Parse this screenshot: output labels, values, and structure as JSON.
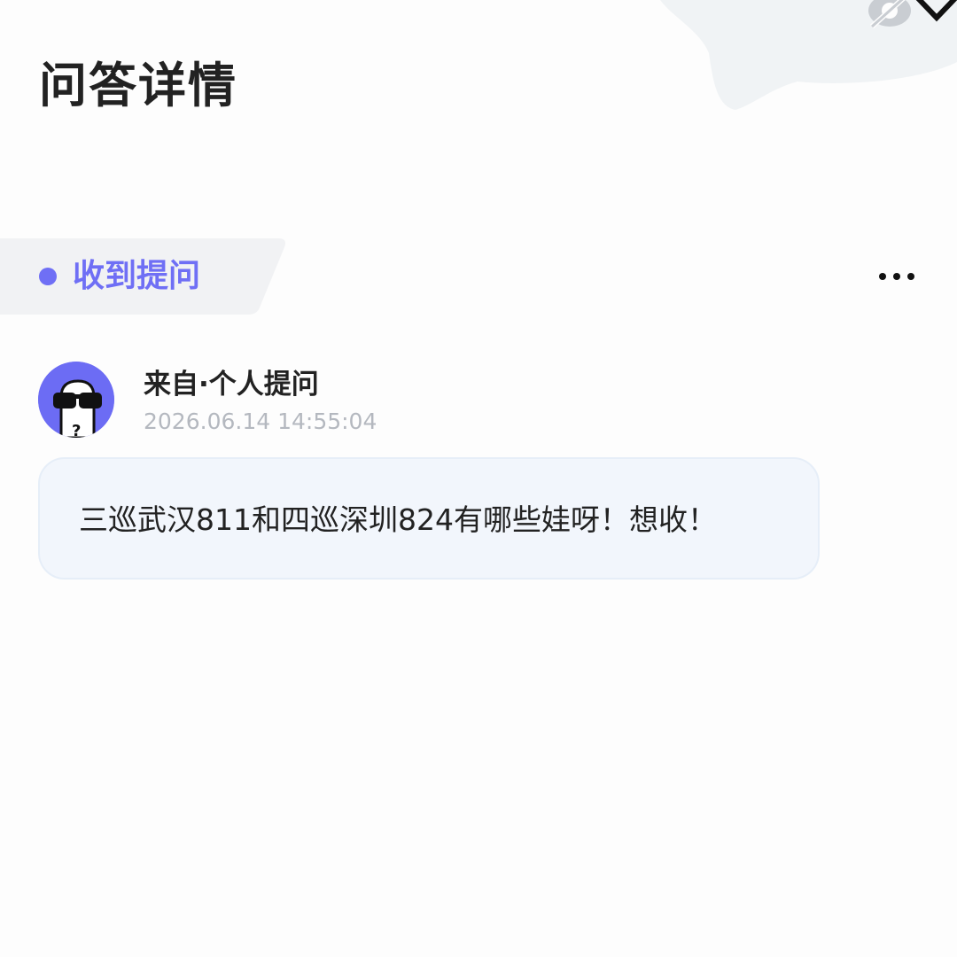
{
  "header": {
    "title": "问答详情",
    "icons": [
      "visibility-off-icon",
      "shield-icon"
    ]
  },
  "section": {
    "label": "收到提问",
    "more_icon": "more-icon"
  },
  "question": {
    "source": "来自·个人提问",
    "timestamp": "2026.06.14 14:55:04",
    "avatar_icon": "avatar-sunglasses-icon",
    "text": "三巡武汉811和四巡深圳824有哪些娃呀！想收！"
  },
  "colors": {
    "accent": "#6f6ff5",
    "bubble_bg": "#f2f6fc",
    "tag_bg": "#f1f2f4",
    "timestamp": "#b4b8bf"
  }
}
